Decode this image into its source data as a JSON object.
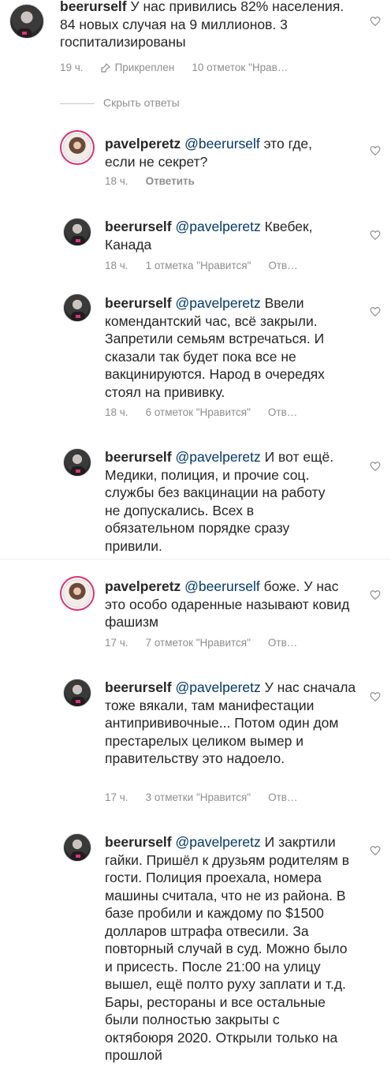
{
  "comments": [
    {
      "username": "beerurself",
      "mention": "",
      "text": "У нас привились 82% населения. 84 новых случая на 9 миллионов. 3 госпитализированы",
      "time": "19 ч.",
      "pinned": "Прикреплен",
      "likes": "10 отметок \"Нрав…",
      "reply": ""
    },
    {
      "username": "pavelperetz",
      "mention": "@beerurself",
      "text": "это где, если не секрет?",
      "time": "18 ч.",
      "likes": "",
      "reply": "Ответить"
    },
    {
      "username": "beerurself",
      "mention": "@pavelperetz",
      "text": "Квебек, Канада",
      "time": "18 ч.",
      "likes": "1 отметка \"Нравится\"",
      "reply": "Отв…"
    },
    {
      "username": "beerurself",
      "mention": "@pavelperetz",
      "text": "Ввели комендантский час, всё закрыли. Запретили семьям встречаться. И сказали так будет пока все не вакцинируются. Народ в очередях стоял на прививку.",
      "time": "18 ч.",
      "likes": "6 отметок \"Нравится\"",
      "reply": "Отв…"
    },
    {
      "username": "beerurself",
      "mention": "@pavelperetz",
      "text": " И вот ещё. Медики, полиция, и прочие соц. службы без вакцинации на работу не допускались. Всех в обязательном порядке сразу привили.",
      "time": "",
      "likes": "",
      "reply": ""
    },
    {
      "username": "pavelperetz",
      "mention": "@beerurself",
      "text": "боже. У нас это особо одаренные называют ковид фашизм",
      "time": "17 ч.",
      "likes": "7 отметок \"Нравится\"",
      "reply": "Отв…"
    },
    {
      "username": "beerurself",
      "mention": "@pavelperetz",
      "text": "У нас сначала тоже вякали, там манифестации антипрививочные... Потом один дом престарелых целиком вымер и правительству это надоело.",
      "time": "17 ч.",
      "likes": "3 отметки \"Нравится\"",
      "reply": "Отв…"
    },
    {
      "username": "beerurself",
      "mention": "@pavelperetz",
      "text": "И закртили гайки. Пришёл к друзьям родителям в гости. Полиция проехала, номера машины считала, что не из района. В базе пробили и каждому по $1500 долларов штрафа отвесили. За повторный случай в суд. Можно было и присесть. После 21:00 на улицу вышел, ещё полто  руху заплати и т.д. Бары, рестораны и все остальные были полностью закрыты с октябоюря 2020. Открыли только на прошлой",
      "time": "",
      "likes": "",
      "reply": ""
    }
  ],
  "hide_replies": "Скрыть ответы",
  "colors": {
    "meta": "#8e8e8e",
    "text": "#262626",
    "mention": "#00376b"
  },
  "icons": {
    "like": "heart-outline-icon",
    "pin": "pin-icon"
  }
}
